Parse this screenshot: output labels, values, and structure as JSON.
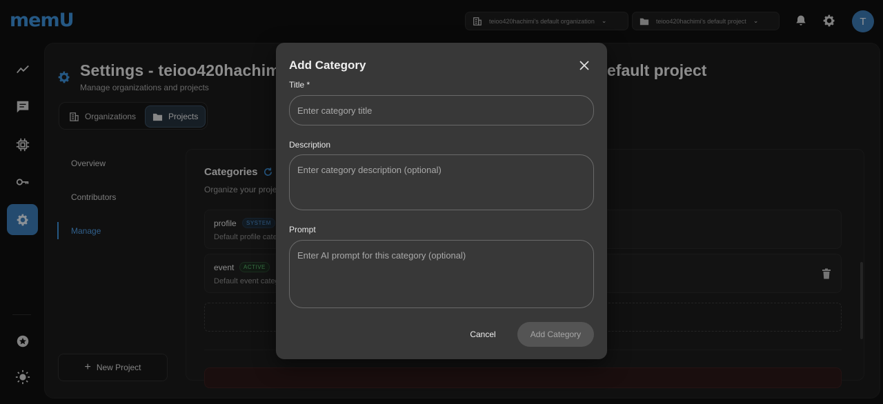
{
  "brand": {
    "logo_text": "memU"
  },
  "topbar": {
    "org_selector": "teioo420hachimi's default organization",
    "project_selector": "teioo420hachimi's default project",
    "avatar_initial": "T"
  },
  "page": {
    "title_left": "Settings - teioo420hachim",
    "title_right": "efault project",
    "subtitle": "Manage organizations and projects"
  },
  "tabs": [
    {
      "label": "Organizations",
      "icon": "building-icon"
    },
    {
      "label": "Projects",
      "icon": "folder-icon",
      "active": true
    }
  ],
  "side_nav": [
    {
      "label": "Overview"
    },
    {
      "label": "Contributors"
    },
    {
      "label": "Manage",
      "active": true
    }
  ],
  "new_project_label": "New Project",
  "categories": {
    "title": "Categories",
    "subtitle": "Organize your projec",
    "items": [
      {
        "name": "profile",
        "badge": "SYSTEM",
        "description": "Default profile categ"
      },
      {
        "name": "event",
        "badge": "ACTIVE",
        "description": "Default event categ"
      }
    ]
  },
  "modal": {
    "title": "Add Category",
    "title_label": "Title *",
    "title_placeholder": "Enter category title",
    "title_value": "",
    "description_label": "Description",
    "description_placeholder": "Enter category description (optional)",
    "description_value": "",
    "prompt_label": "Prompt",
    "prompt_placeholder": "Enter AI prompt for this category (optional)",
    "prompt_value": "",
    "cancel_label": "Cancel",
    "submit_label": "Add Category"
  },
  "colors": {
    "accent": "#3d8fd6",
    "modal_bg": "#383838",
    "badge_system": "#4c8fd0",
    "badge_active": "#58b36a"
  }
}
